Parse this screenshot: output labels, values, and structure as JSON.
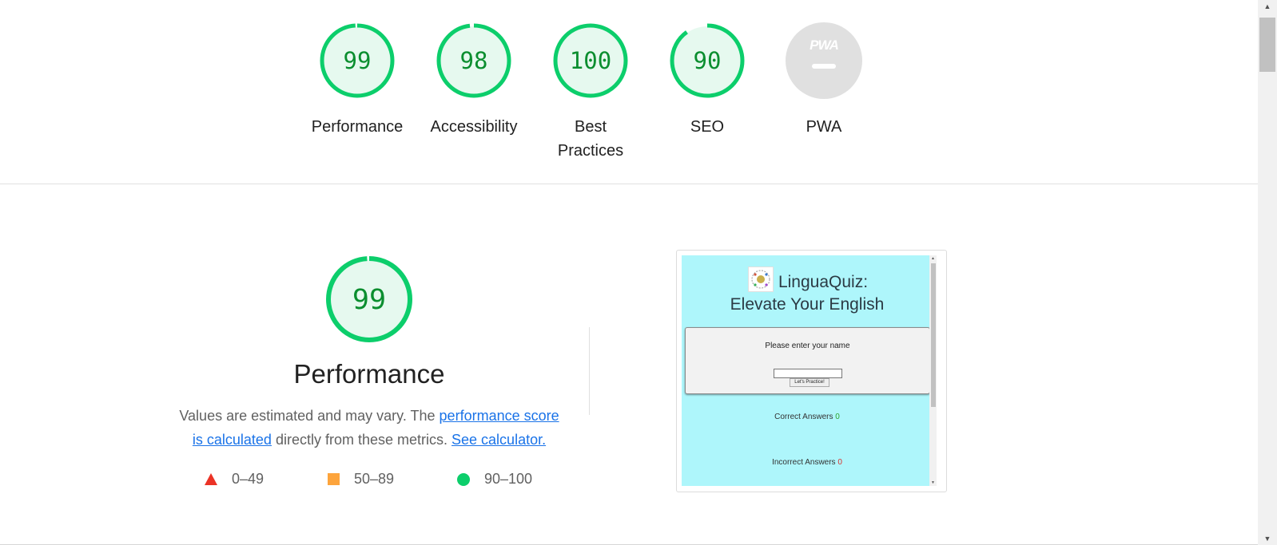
{
  "summary": {
    "gauges": [
      {
        "score": 0.99,
        "value": "99",
        "label": "Performance",
        "color": "#0cce6b"
      },
      {
        "score": 0.98,
        "value": "98",
        "label": "Accessibility",
        "color": "#0cce6b"
      },
      {
        "score": 1.0,
        "value": "100",
        "label_line1": "Best",
        "label_line2": "Practices",
        "color": "#0cce6b"
      },
      {
        "score": 0.9,
        "value": "90",
        "label": "SEO",
        "color": "#0cce6b"
      },
      {
        "value": "—",
        "label": "PWA",
        "badge": "PWA",
        "color": "#e0e0e0"
      }
    ]
  },
  "performance": {
    "score": 0.99,
    "value": "99",
    "title": "Performance",
    "description_prefix": "Values are estimated and may vary. The ",
    "link_score": "performance score is calculated",
    "description_middle": " directly from these metrics. ",
    "link_calculator": "See calculator.",
    "legend": [
      {
        "icon": "triangle-icon",
        "color": "#eb3326",
        "range": "0–49"
      },
      {
        "icon": "square-icon",
        "color": "#fda43c",
        "range": "50–89"
      },
      {
        "icon": "circle-icon",
        "color": "#0cce6b",
        "range": "90–100"
      }
    ]
  },
  "screenshot": {
    "title_line1": "LinguaQuiz:",
    "title_line2": "Elevate Your English",
    "prompt": "Please enter your name",
    "button": "Let's Practice!",
    "correct_label": "Correct Answers",
    "correct_value": "0",
    "incorrect_label": "Incorrect Answers",
    "incorrect_value": "0",
    "bg_color": "#aef6fb"
  }
}
